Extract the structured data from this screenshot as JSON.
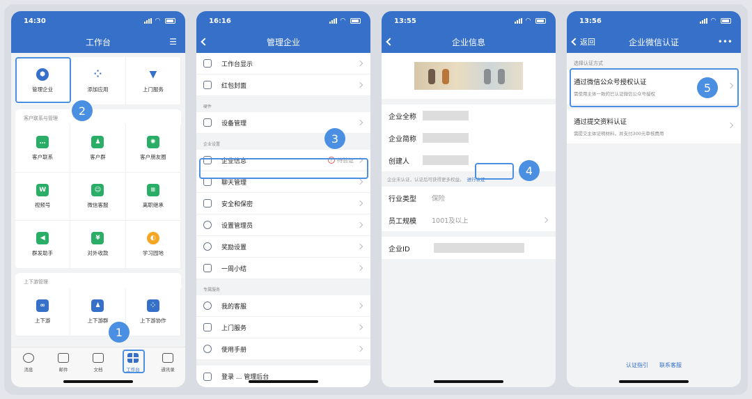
{
  "phone1": {
    "time": "14:30",
    "title": "工作台",
    "top_items": [
      "管理企业",
      "添加应用",
      "上门服务"
    ],
    "section_contacts": "客户联系与管理",
    "contact_items": [
      "客户联系",
      "客户群",
      "客户朋友圈",
      "视频号",
      "微信客服",
      "离职继承",
      "群发助手",
      "对外收款",
      "学习园地"
    ],
    "section_updown": "上下游管理",
    "updown_items": [
      "上下游",
      "上下游群",
      "上下游协作"
    ],
    "tabs": [
      "消息",
      "邮件",
      "文档",
      "工作台",
      "通讯录"
    ],
    "badge1": "1",
    "badge2": "2"
  },
  "phone2": {
    "time": "16:16",
    "title": "管理企业",
    "rows_top": [
      "工作台显示",
      "红包封面"
    ],
    "group_hardware": "硬件",
    "rows_hw": [
      "设备管理"
    ],
    "group_settings": "企业设置",
    "rows_settings": [
      "企业信息",
      "聊天管理",
      "安全和保密",
      "设置管理员",
      "奖励设置",
      "一周小结"
    ],
    "pending": "待验证",
    "group_service": "专属服务",
    "rows_service": [
      "我的客服",
      "上门服务",
      "使用手册"
    ],
    "cut_row": "登录 ... 管理后台",
    "badge3": "3"
  },
  "phone3": {
    "time": "13:55",
    "title": "企业信息",
    "fields": [
      "企业全称",
      "企业简称",
      "创建人"
    ],
    "note": "企业未认证，认证后可获得更多权益。",
    "note_link": "进行认证",
    "industry_label": "行业类型",
    "industry_value": "保险",
    "size_label": "员工规模",
    "size_value": "1001及以上",
    "id_label": "企业ID",
    "badge4": "4"
  },
  "phone4": {
    "time": "13:56",
    "back": "返回",
    "title": "企业微信认证",
    "more": "•••",
    "section": "选择认证方式",
    "option1_title": "通过微信公众号授权认证",
    "option1_desc": "需使用主体一致的已认证微信公众号授权",
    "option2_title": "通过提交资料认证",
    "option2_desc": "需提交主体证明材料，并支付300元审核费用",
    "link_guide": "认证指引",
    "link_service": "联系客服",
    "badge5": "5"
  },
  "colors": {
    "brand": "#3670c8",
    "highlight": "#4a8fe2",
    "green": "#2aae67"
  }
}
